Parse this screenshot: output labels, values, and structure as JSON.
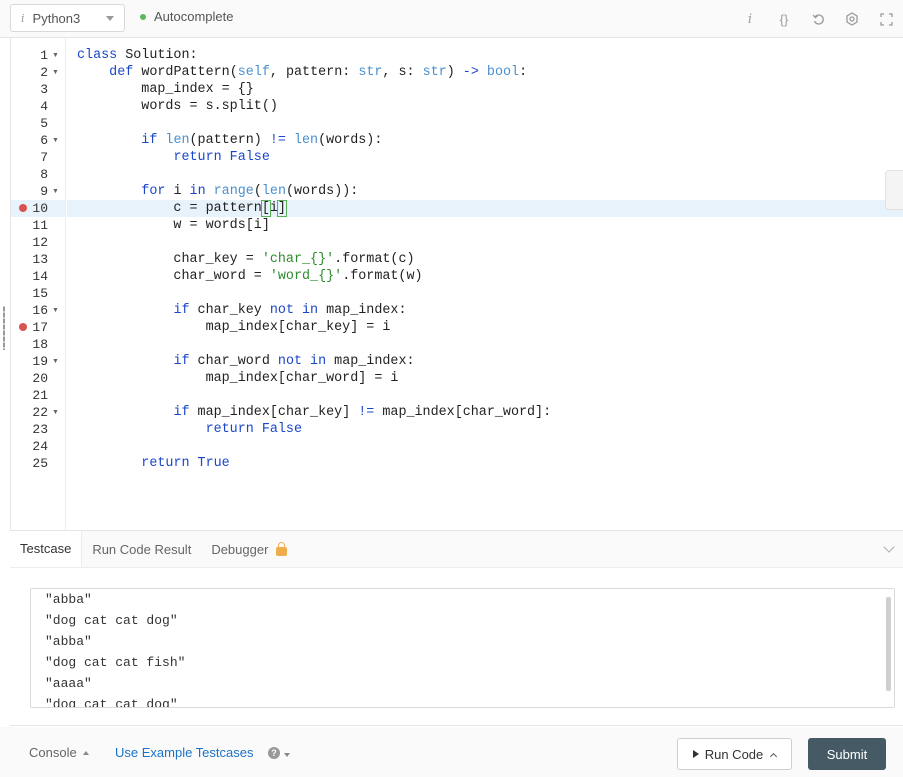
{
  "toolbar": {
    "language": "Python3",
    "autocomplete_label": "Autocomplete",
    "icons": [
      "info-icon",
      "braces-icon",
      "undo-icon",
      "settings-icon",
      "fullscreen-icon"
    ]
  },
  "editor": {
    "breakpoint_lines": [
      10,
      17
    ],
    "fold_lines": [
      1,
      2,
      6,
      9,
      16,
      19,
      22
    ],
    "active_line": 10,
    "lines": [
      [
        [
          "kw",
          "class "
        ],
        [
          "pl",
          "Solution:"
        ]
      ],
      [
        [
          "pl",
          "    "
        ],
        [
          "kw",
          "def "
        ],
        [
          "pl",
          "wordPattern("
        ],
        [
          "bi",
          "self"
        ],
        [
          "pl",
          ", pattern: "
        ],
        [
          "bi",
          "str"
        ],
        [
          "pl",
          ", s: "
        ],
        [
          "bi",
          "str"
        ],
        [
          "pl",
          ") "
        ],
        [
          "kw",
          "-> "
        ],
        [
          "bi",
          "bool"
        ],
        [
          "pl",
          ":"
        ]
      ],
      [
        [
          "pl",
          "        map_index = {}"
        ]
      ],
      [
        [
          "pl",
          "        words = s.split()"
        ]
      ],
      [],
      [
        [
          "pl",
          "        "
        ],
        [
          "kw",
          "if "
        ],
        [
          "bi",
          "len"
        ],
        [
          "pl",
          "(pattern) "
        ],
        [
          "kw",
          "!= "
        ],
        [
          "bi",
          "len"
        ],
        [
          "pl",
          "(words):"
        ]
      ],
      [
        [
          "pl",
          "            "
        ],
        [
          "kw",
          "return False"
        ]
      ],
      [],
      [
        [
          "pl",
          "        "
        ],
        [
          "kw",
          "for "
        ],
        [
          "pl",
          "i "
        ],
        [
          "kw",
          "in "
        ],
        [
          "bi",
          "range"
        ],
        [
          "pl",
          "("
        ],
        [
          "bi",
          "len"
        ],
        [
          "pl",
          "(words)):"
        ]
      ],
      [
        [
          "pl",
          "            c = pattern"
        ],
        [
          "br",
          "["
        ],
        [
          "pl",
          "i"
        ],
        [
          "br",
          "]"
        ]
      ],
      [
        [
          "pl",
          "            w = words[i]"
        ]
      ],
      [],
      [
        [
          "pl",
          "            char_key = "
        ],
        [
          "str",
          "'char_{}'"
        ],
        [
          "pl",
          ".format(c)"
        ]
      ],
      [
        [
          "pl",
          "            char_word = "
        ],
        [
          "str",
          "'word_{}'"
        ],
        [
          "pl",
          ".format(w)"
        ]
      ],
      [],
      [
        [
          "pl",
          "            "
        ],
        [
          "kw",
          "if "
        ],
        [
          "pl",
          "char_key "
        ],
        [
          "kw",
          "not in "
        ],
        [
          "pl",
          "map_index:"
        ]
      ],
      [
        [
          "pl",
          "                map_index[char_key] = i"
        ]
      ],
      [],
      [
        [
          "pl",
          "            "
        ],
        [
          "kw",
          "if "
        ],
        [
          "pl",
          "char_word "
        ],
        [
          "kw",
          "not in "
        ],
        [
          "pl",
          "map_index:"
        ]
      ],
      [
        [
          "pl",
          "                map_index[char_word] = i"
        ]
      ],
      [],
      [
        [
          "pl",
          "            "
        ],
        [
          "kw",
          "if "
        ],
        [
          "pl",
          "map_index[char_key] "
        ],
        [
          "kw",
          "!= "
        ],
        [
          "pl",
          "map_index[char_word]:"
        ]
      ],
      [
        [
          "pl",
          "                "
        ],
        [
          "kw",
          "return False"
        ]
      ],
      [],
      [
        [
          "pl",
          "        "
        ],
        [
          "kw",
          "return True"
        ]
      ]
    ]
  },
  "panel": {
    "tabs": [
      "Testcase",
      "Run Code Result",
      "Debugger"
    ],
    "testcases": [
      "\"abba\"",
      "\"dog cat cat dog\"",
      "\"abba\"",
      "\"dog cat cat fish\"",
      "\"aaaa\"",
      "\"dog cat cat dog\""
    ]
  },
  "footer": {
    "console_label": "Console",
    "use_example_label": "Use Example Testcases",
    "help_glyph": "?",
    "run_label": "Run Code",
    "submit_label": "Submit"
  },
  "colors": {
    "keyword": "#1a47c9",
    "builtin": "#4a8fd0",
    "string": "#2e8b2e",
    "breakpoint": "#d9534f",
    "active_line_bg": "#e8f2fb",
    "link": "#1a73c8",
    "submit_bg": "#455a64"
  }
}
